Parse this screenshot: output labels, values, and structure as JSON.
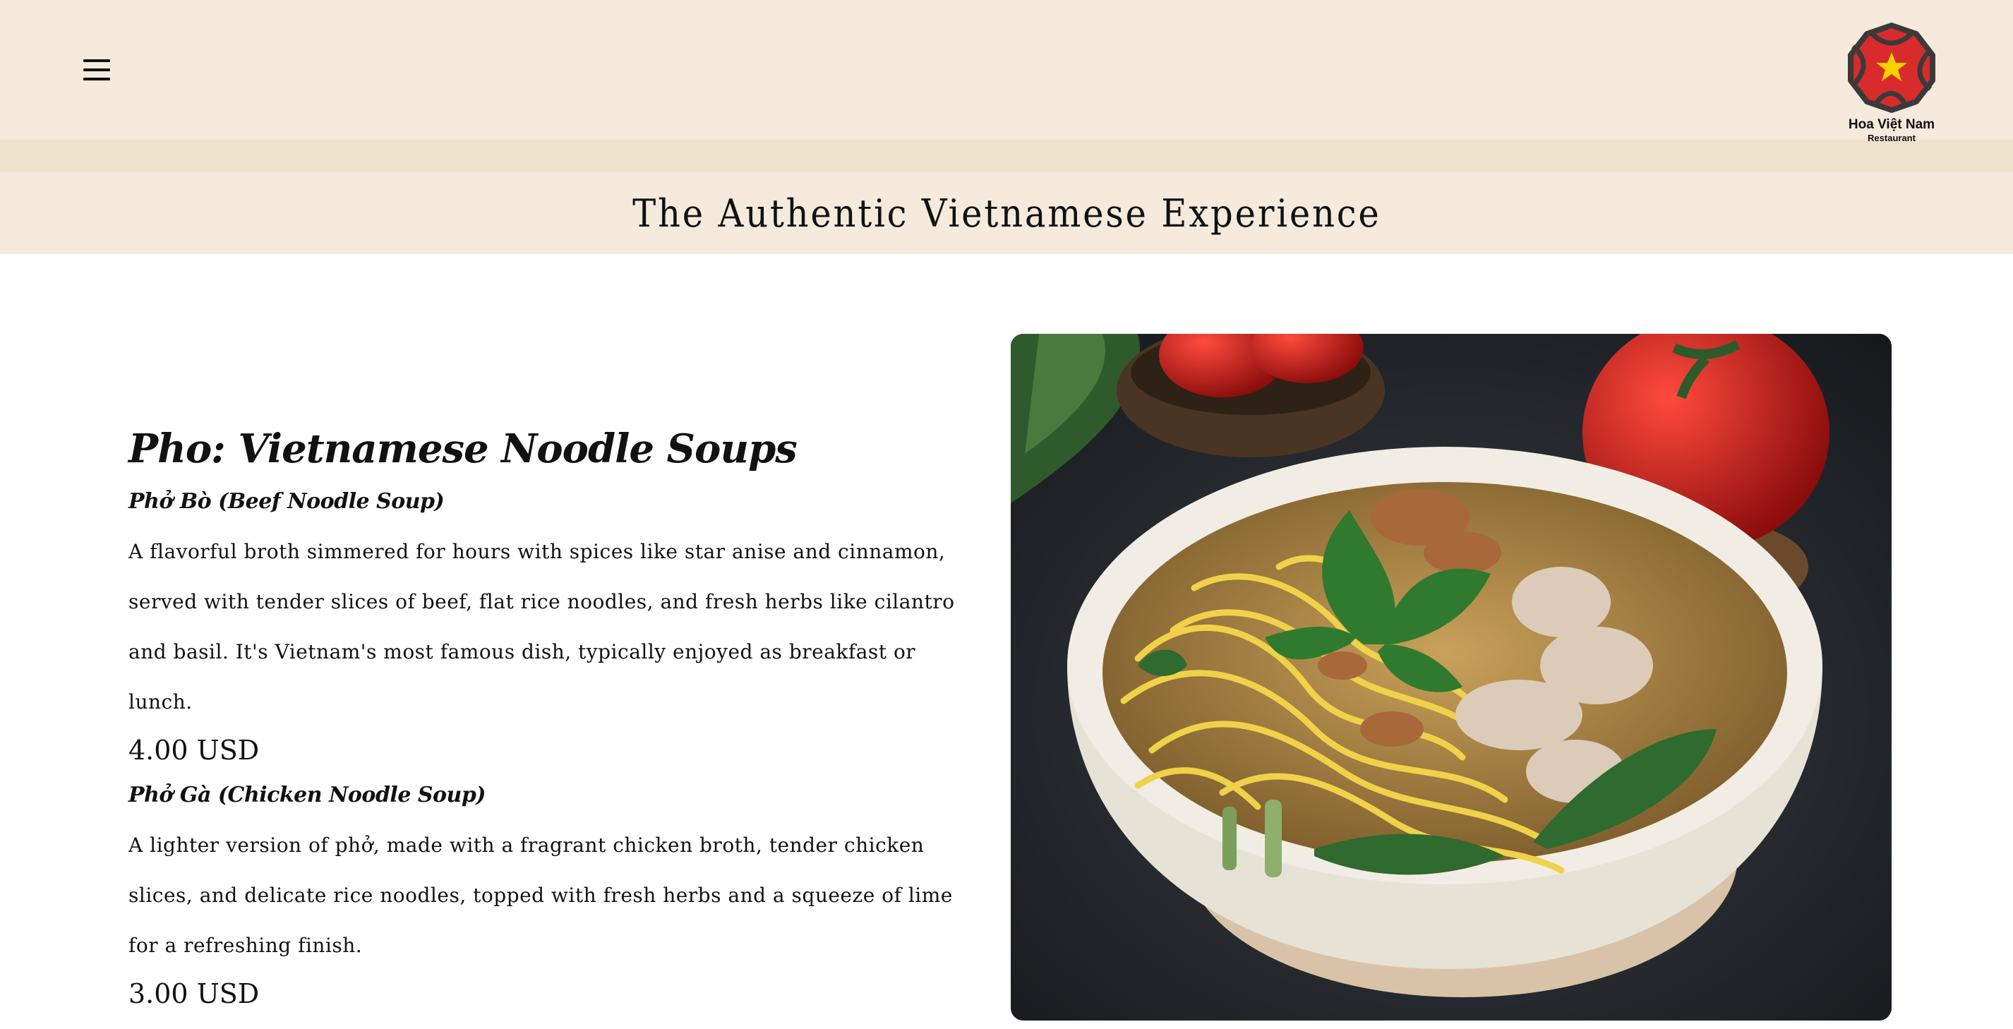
{
  "header": {
    "menu_icon": "hamburger-menu-icon",
    "logo": {
      "name": "Hoa Việt Nam",
      "sub": "Restaurant",
      "colors": {
        "petal": "#d92b2b",
        "outline": "#3a3a3a",
        "star": "#f7d000"
      }
    },
    "title": "The Authentic Vietnamese Experience"
  },
  "menu": {
    "section_title": "Pho: Vietnamese Noodle Soups",
    "dishes": [
      {
        "name": "Phở Bò (Beef Noodle Soup)",
        "description": "A flavorful broth simmered for hours with spices like star anise and cinnamon, served with tender slices of beef, flat rice noodles, and fresh herbs like cilantro and basil. It's Vietnam's most famous dish, typically enjoyed as breakfast or lunch.",
        "price": "4.00 USD"
      },
      {
        "name": "Phở Gà (Chicken Noodle Soup)",
        "description": "A lighter version of phở, made with a fragrant chicken broth, tender chicken slices, and delicate rice noodles, topped with fresh herbs and a squeeze of lime for a refreshing finish.",
        "price": "3.00 USD"
      }
    ]
  },
  "colors": {
    "header_bg": "#f5eadb",
    "band_bg": "#efe2cc",
    "text": "#111111"
  }
}
